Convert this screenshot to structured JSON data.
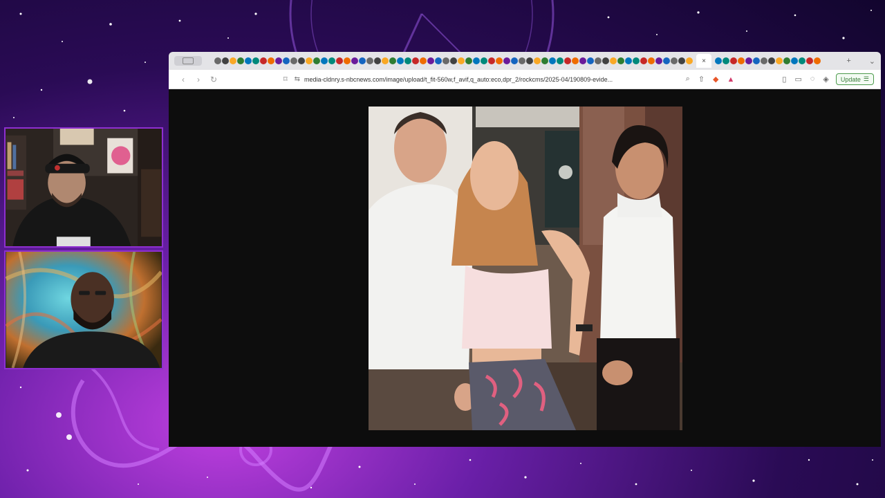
{
  "browser": {
    "url": "media-cldnry.s-nbcnews.com/image/upload/t_fit-560w,f_avif,q_auto:eco,dpr_2/rockcms/2025-04/190809-evide...",
    "update_label": "Update",
    "tab_close_glyph": "×",
    "new_tab_glyph": "+",
    "tab_menu_glyph": "⌄"
  },
  "photo": {
    "description_alt": "Photograph displayed in browser image viewer"
  },
  "cams": [
    {
      "name": "webcam-host-1"
    },
    {
      "name": "webcam-host-2"
    }
  ],
  "colors": {
    "background_accent": "#6a1fa8",
    "cam_border": "#8e2fd0",
    "update_green": "#3a7d3a"
  }
}
